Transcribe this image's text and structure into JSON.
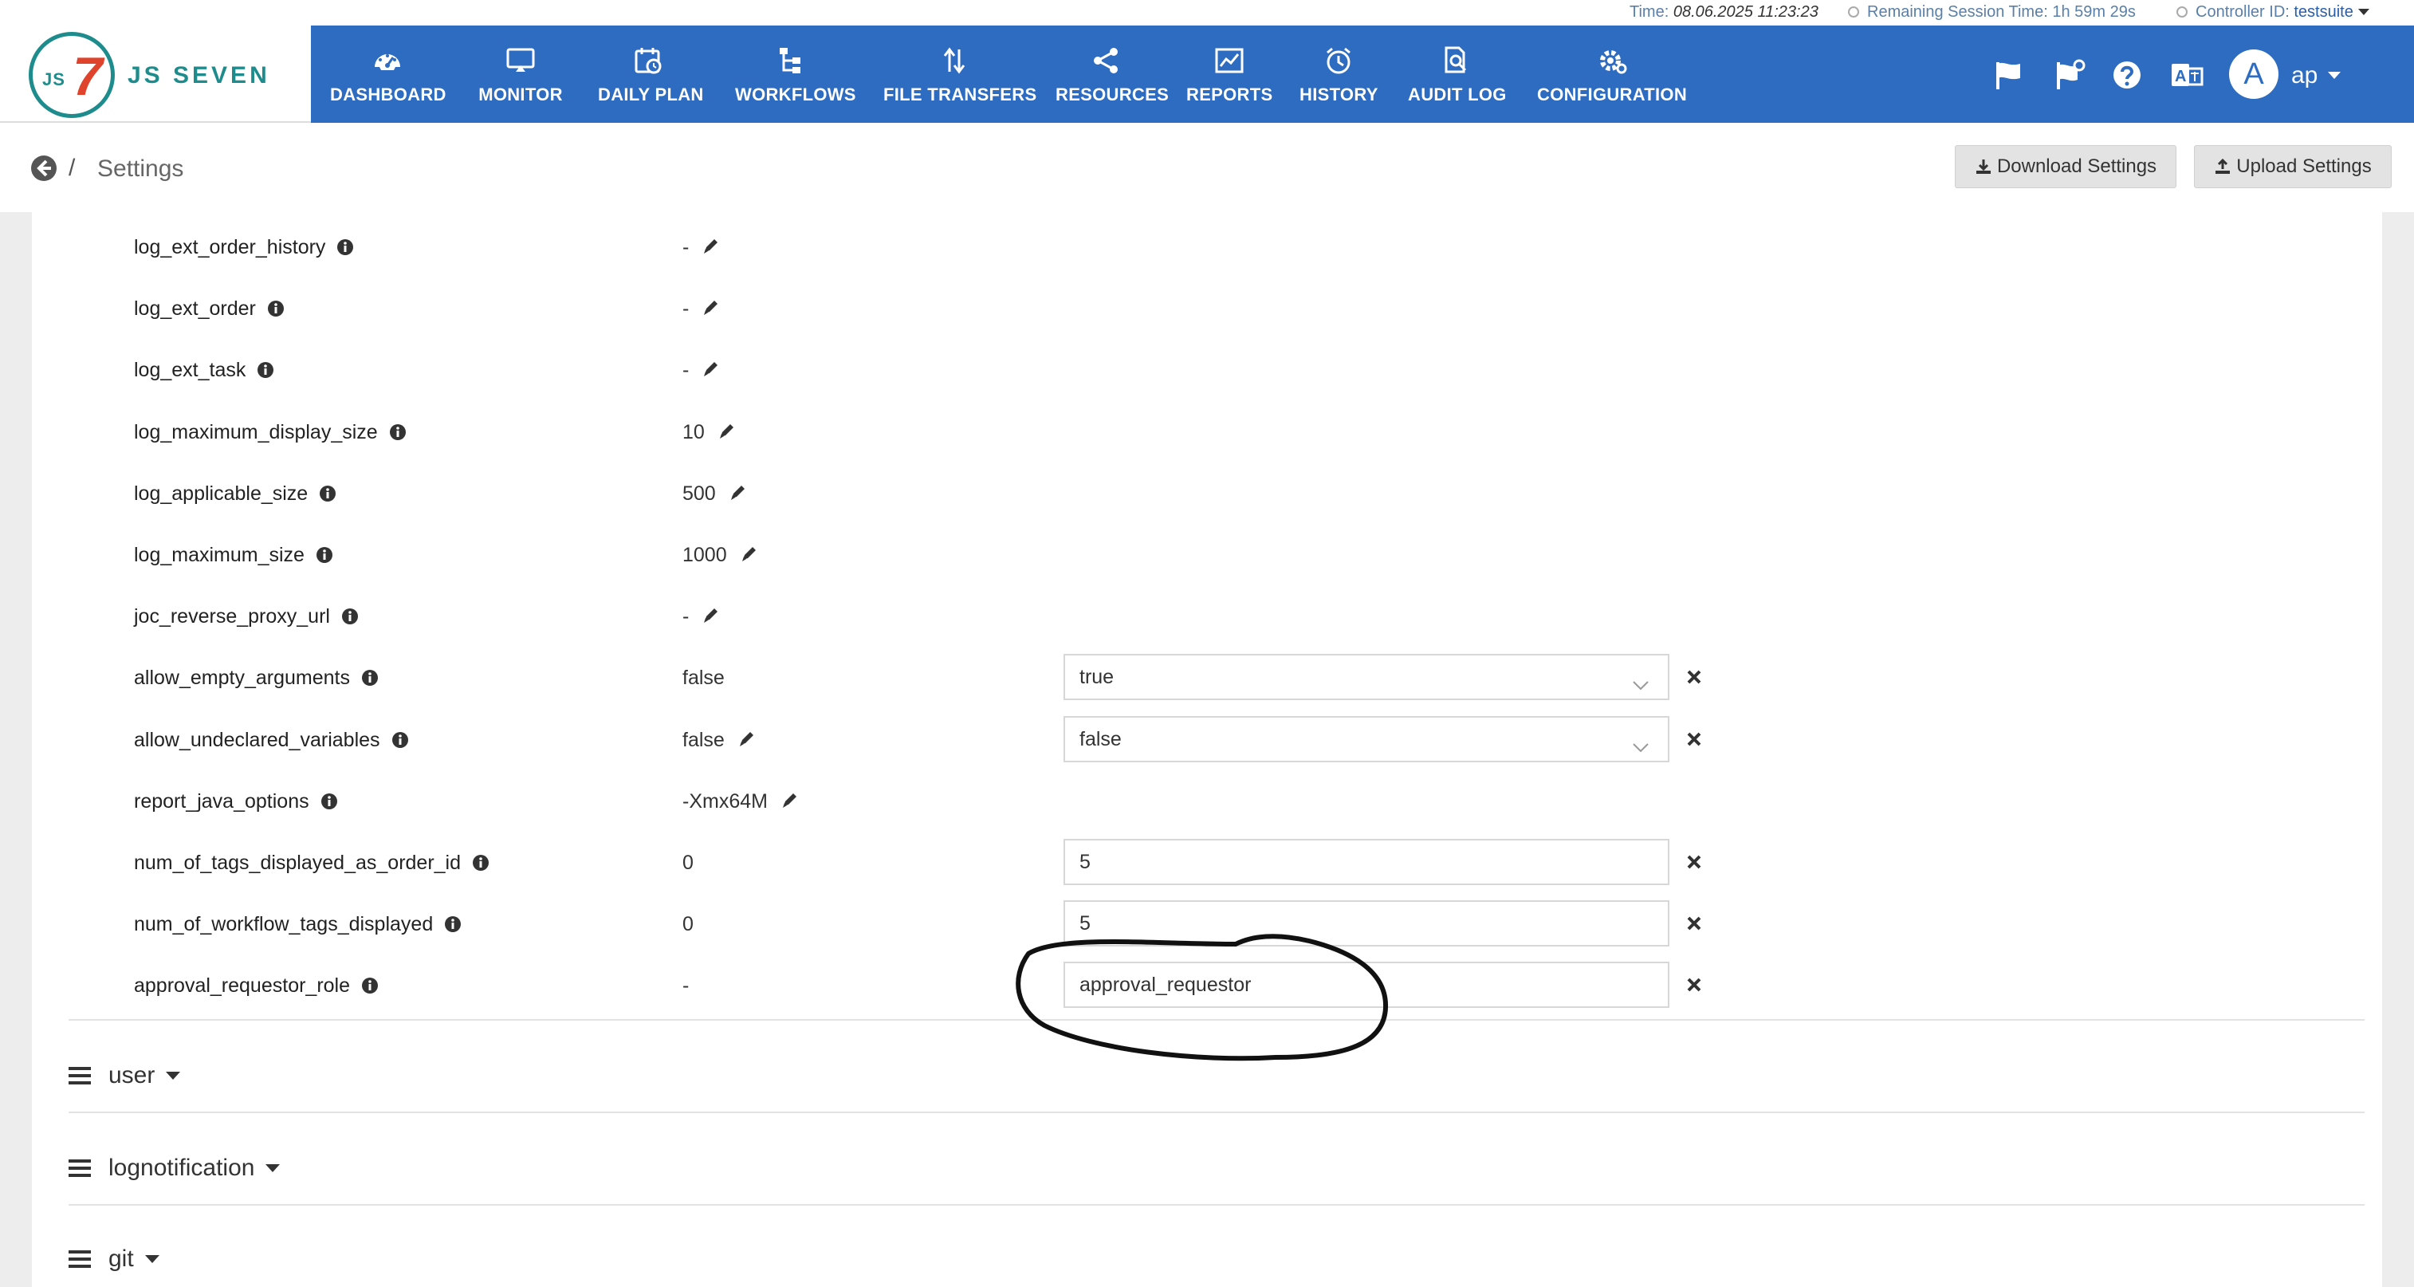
{
  "status": {
    "time_label": "Time:",
    "time_value": "08.06.2025 11:23:23",
    "session_label": "Remaining Session Time:",
    "session_value": "1h 59m 29s",
    "controller_label": "Controller ID:",
    "controller_value": "testsuite"
  },
  "brand": {
    "logo_letters": "JS",
    "logo_mark": "7",
    "name": "JS SEVEN"
  },
  "nav": [
    {
      "label": "DASHBOARD",
      "icon": "dashboard-icon"
    },
    {
      "label": "MONITOR",
      "icon": "monitor-icon"
    },
    {
      "label": "DAILY PLAN",
      "icon": "calendar-icon"
    },
    {
      "label": "WORKFLOWS",
      "icon": "workflow-icon"
    },
    {
      "label": "FILE TRANSFERS",
      "icon": "transfer-icon"
    },
    {
      "label": "RESOURCES",
      "icon": "share-icon"
    },
    {
      "label": "REPORTS",
      "icon": "chart-icon"
    },
    {
      "label": "HISTORY",
      "icon": "clock-icon"
    },
    {
      "label": "AUDIT LOG",
      "icon": "audit-icon"
    },
    {
      "label": "CONFIGURATION",
      "icon": "gear-icon"
    }
  ],
  "user": {
    "initial": "A",
    "name": "ap"
  },
  "breadcrumb": {
    "separator": "/",
    "title": "Settings"
  },
  "buttons": {
    "download": "Download Settings",
    "upload": "Upload Settings"
  },
  "settings": [
    {
      "name": "log_ext_order_history",
      "current": "-",
      "editable": true
    },
    {
      "name": "log_ext_order",
      "current": "-",
      "editable": true
    },
    {
      "name": "log_ext_task",
      "current": "-",
      "editable": true
    },
    {
      "name": "log_maximum_display_size",
      "current": "10",
      "editable": true
    },
    {
      "name": "log_applicable_size",
      "current": "500",
      "editable": true
    },
    {
      "name": "log_maximum_size",
      "current": "1000",
      "editable": true
    },
    {
      "name": "joc_reverse_proxy_url",
      "current": "-",
      "editable": true
    },
    {
      "name": "allow_empty_arguments",
      "current": "false",
      "editable": false,
      "input_type": "select",
      "input_value": "true"
    },
    {
      "name": "allow_undeclared_variables",
      "current": "false",
      "editable": true,
      "input_type": "select",
      "input_value": "false"
    },
    {
      "name": "report_java_options",
      "current": "-Xmx64M",
      "editable": true
    },
    {
      "name": "num_of_tags_displayed_as_order_id",
      "current": "0",
      "editable": false,
      "input_type": "text",
      "input_value": "5"
    },
    {
      "name": "num_of_workflow_tags_displayed",
      "current": "0",
      "editable": false,
      "input_type": "text",
      "input_value": "5"
    },
    {
      "name": "approval_requestor_role",
      "current": "-",
      "editable": false,
      "input_type": "text",
      "input_value": "approval_requestor"
    }
  ],
  "sections": [
    {
      "name": "user"
    },
    {
      "name": "lognotification"
    },
    {
      "name": "git"
    }
  ],
  "colors": {
    "header": "#2d6cc0",
    "brand_teal": "#1e8c8c",
    "brand_red": "#e0432c"
  }
}
